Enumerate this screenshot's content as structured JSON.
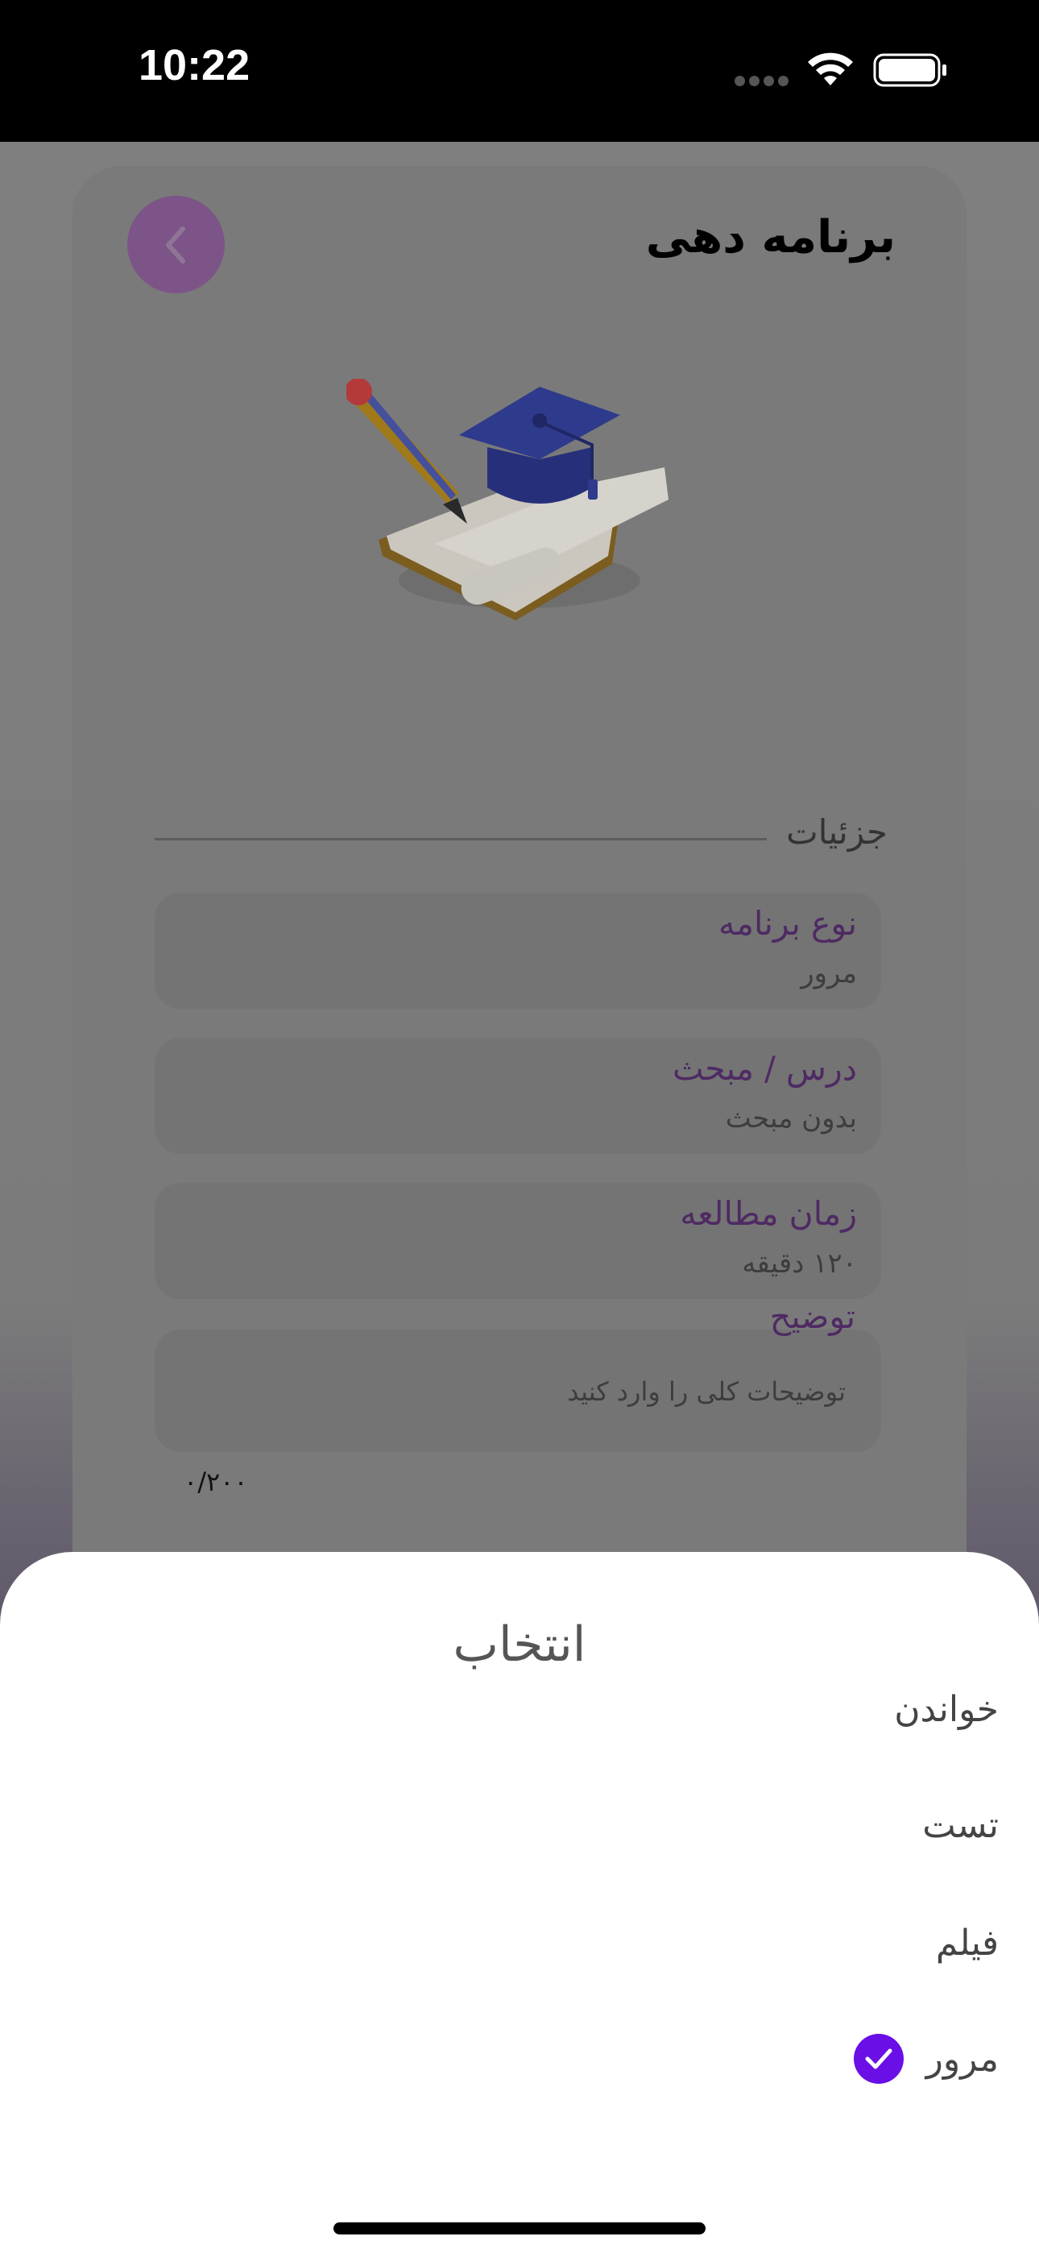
{
  "status_bar": {
    "time": "10:22"
  },
  "header": {
    "title": "برنامه دهی",
    "back_icon": "chevron-left-icon"
  },
  "illustration": {
    "icon": "graduation-cap-books-icon"
  },
  "details": {
    "section_label": "جزئیات",
    "fields": [
      {
        "label": "نوع برنامه",
        "value": "مرور"
      },
      {
        "label": "درس / مبحث",
        "value": "بدون مبحث"
      },
      {
        "label": "زمان مطالعه",
        "value": "۱۲۰ دقیقه"
      }
    ],
    "description": {
      "label": "توضیح",
      "placeholder": "توضیحات کلی را وارد کنید",
      "counter": "۰/۲۰۰"
    }
  },
  "sheet": {
    "title": "انتخاب",
    "options": [
      {
        "label": "خواندن",
        "selected": false
      },
      {
        "label": "تست",
        "selected": false
      },
      {
        "label": "فیلم",
        "selected": false
      },
      {
        "label": "مرور",
        "selected": true
      }
    ]
  },
  "colors": {
    "accent": "#6a0fe6",
    "label_purple": "#4e2a63",
    "back_button": "#7d5487"
  }
}
